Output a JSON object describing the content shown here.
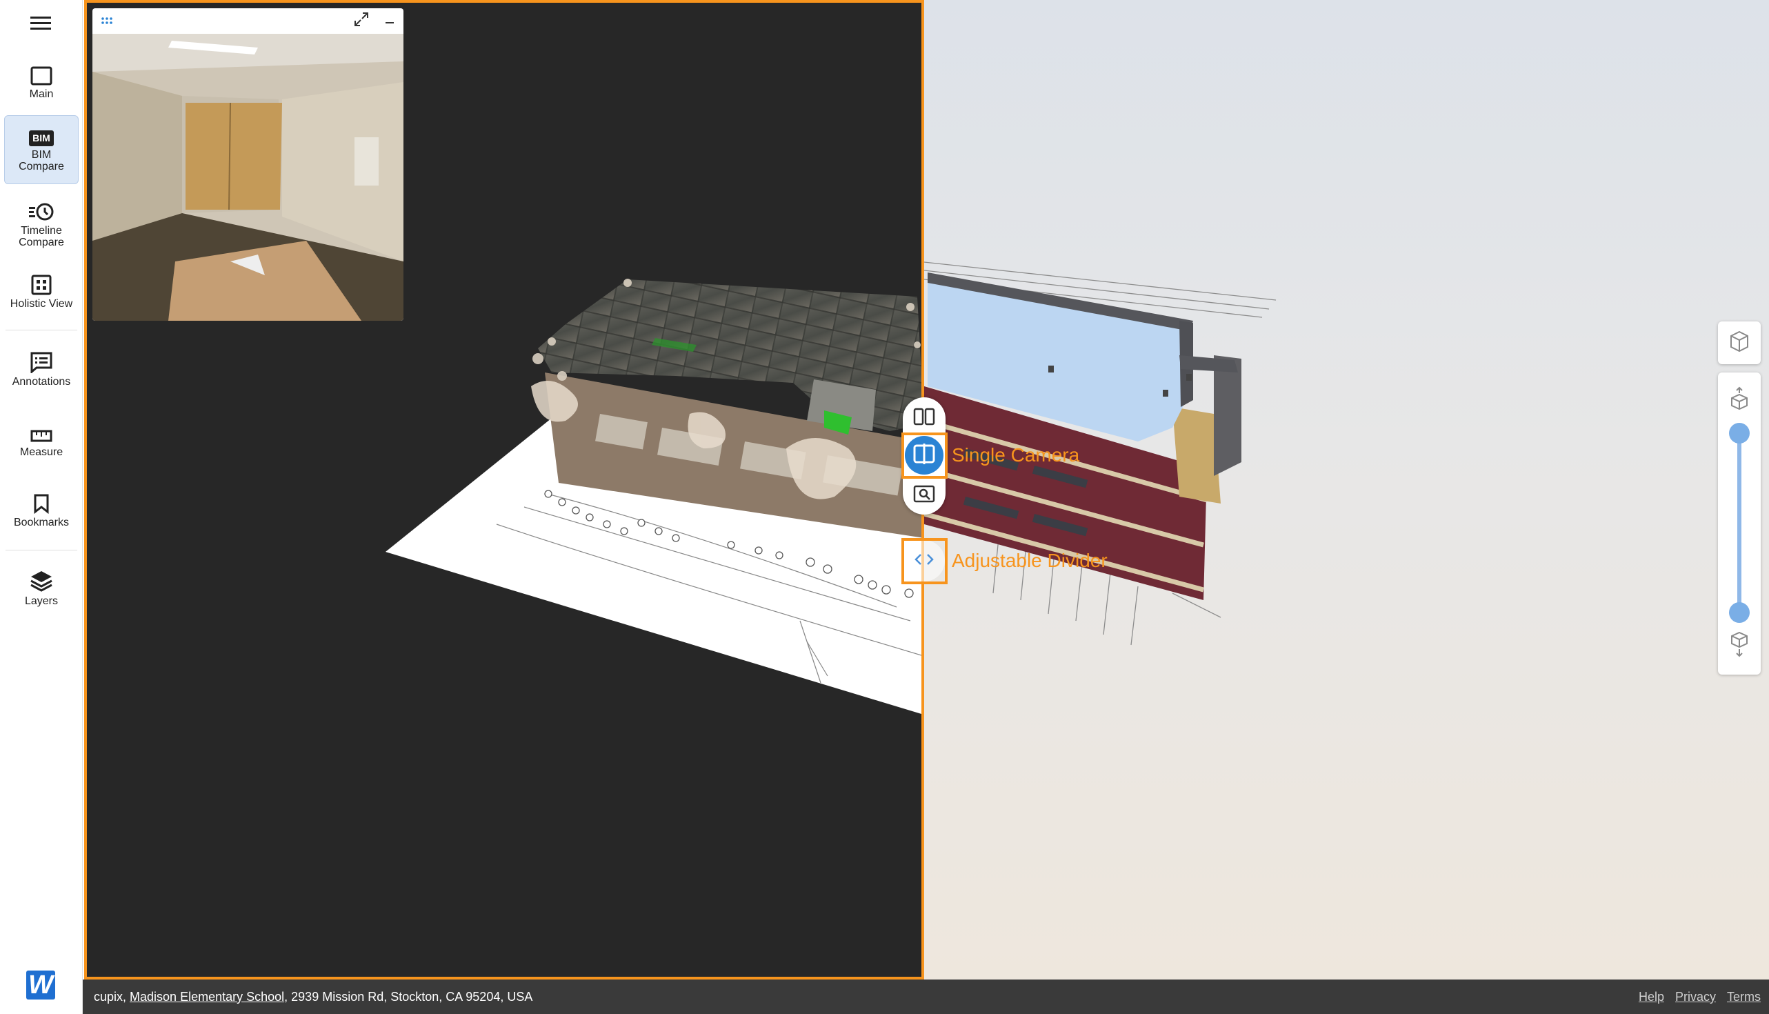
{
  "sidebar": {
    "items": [
      {
        "name": "main",
        "label": "Main",
        "icon": "square-icon"
      },
      {
        "name": "bim-compare",
        "label": "BIM Compare",
        "icon": "bim-icon",
        "active": true
      },
      {
        "name": "timeline-compare",
        "label": "Timeline Compare",
        "icon": "timeline-clock-icon"
      },
      {
        "name": "holistic-view",
        "label": "Holistic View",
        "icon": "grid-icon"
      },
      {
        "name": "annotations",
        "label": "Annotations",
        "icon": "annotation-list-icon"
      },
      {
        "name": "measure",
        "label": "Measure",
        "icon": "ruler-icon"
      },
      {
        "name": "bookmarks",
        "label": "Bookmarks",
        "icon": "bookmark-icon"
      },
      {
        "name": "layers",
        "label": "Layers",
        "icon": "layers-icon"
      }
    ],
    "bim_badge": "BIM",
    "logo_letter": "W"
  },
  "annotations": {
    "single_camera": "Single Camera",
    "adjustable_divider": "Adjustable Divider"
  },
  "statusbar": {
    "company": "cupix, ",
    "project": "Madison Elementary School",
    "address": ", 2939 Mission Rd, Stockton, CA 95204, USA",
    "links": {
      "help": "Help",
      "privacy": "Privacy",
      "terms": "Terms"
    }
  },
  "colors": {
    "accent_orange": "#f7941d",
    "active_blue": "#2a83d4",
    "viewer_dark": "#272727",
    "statusbar": "#3a3a3a"
  }
}
